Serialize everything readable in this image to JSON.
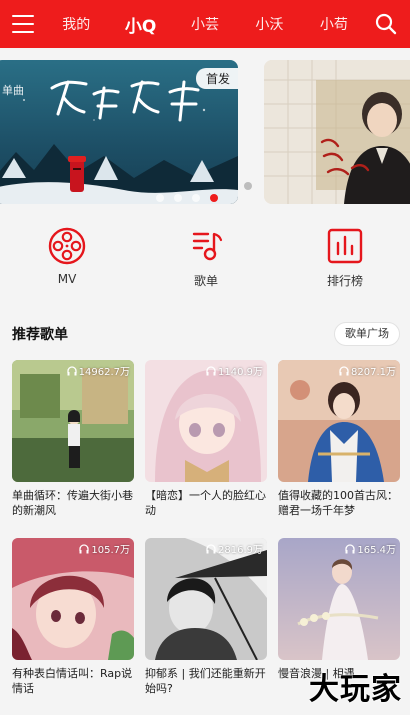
{
  "header": {
    "menu_icon": "hamburger-menu-icon",
    "tabs": [
      {
        "label": "我的"
      },
      {
        "label": "小Q"
      },
      {
        "label": "小芸"
      },
      {
        "label": "小沃"
      },
      {
        "label": "小苟"
      }
    ],
    "active_tab": "小Q",
    "search_icon": "search-icon",
    "accent": "#ee1c1c"
  },
  "banner": {
    "main_badge": "首发",
    "main_script_text": "单曲 无去无来",
    "next_script_text": "爱与我们",
    "dot_count": 5,
    "active_dot_index": 3
  },
  "shortcuts": [
    {
      "label": "MV",
      "icon": "film-reel-icon"
    },
    {
      "label": "歌单",
      "icon": "music-list-icon"
    },
    {
      "label": "排行榜",
      "icon": "bar-chart-icon"
    }
  ],
  "section": {
    "title": "推荐歌单",
    "more_label": "歌单广场"
  },
  "playlists": [
    {
      "plays": "14962.7万",
      "title": "单曲循环：传遍大街小巷的新潮风"
    },
    {
      "plays": "1140.9万",
      "title": "【暗恋】一个人的脸红心动"
    },
    {
      "plays": "8207.1万",
      "title": "值得收藏的100首古风：赠君一场千年梦"
    },
    {
      "plays": "105.7万",
      "title": "有种表白情话叫：Rap说情话"
    },
    {
      "plays": "2816.9万",
      "title": "抑郁系 | 我们还能重新开始吗?"
    },
    {
      "plays": "165.4万",
      "title": "慢音浪漫 | 相遇"
    }
  ],
  "watermark": "大玩家"
}
